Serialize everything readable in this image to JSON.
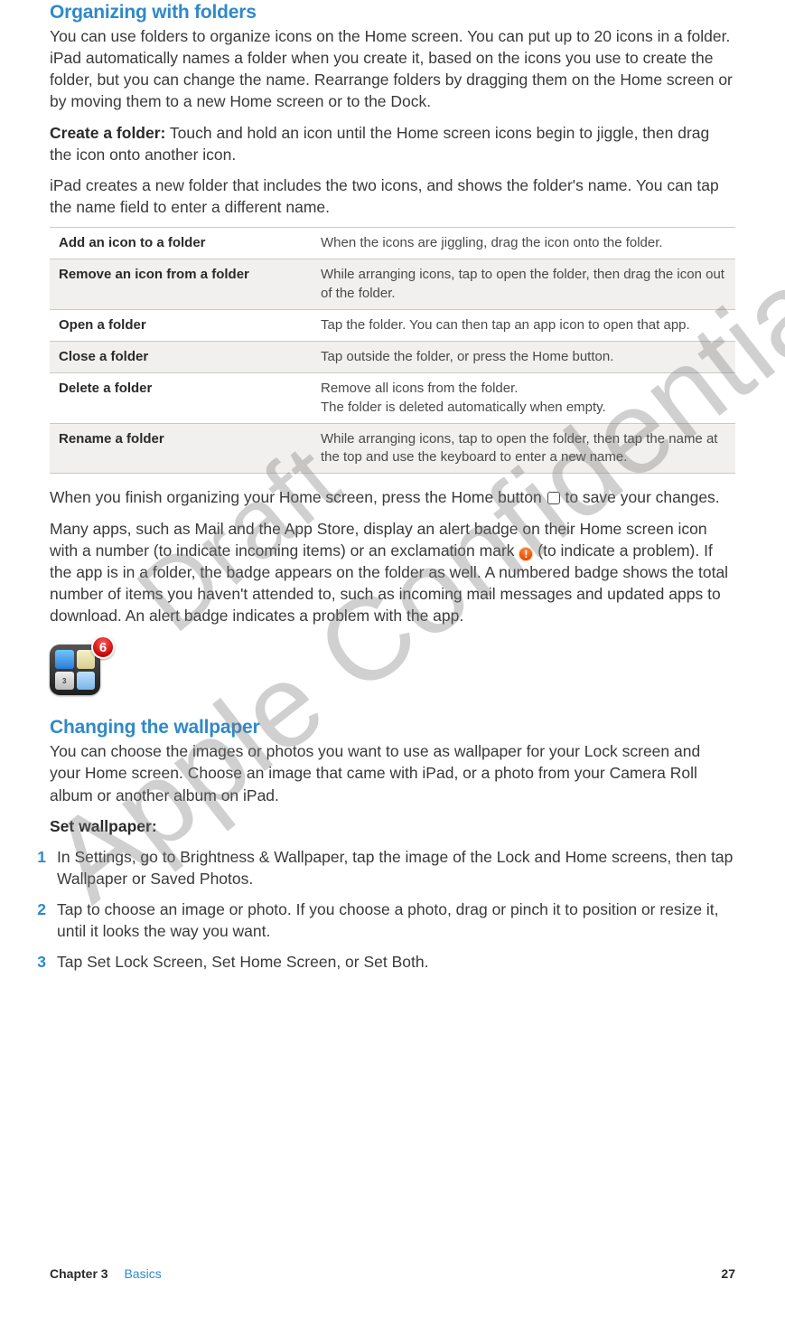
{
  "section1": {
    "heading": "Organizing with folders",
    "para1": "You can use folders to organize icons on the Home screen. You can put up to 20 icons in a folder. iPad automatically names a folder when you create it, based on the icons you use to create the folder, but you can change the name. Rearrange folders by dragging them on the Home screen or by moving them to a new Home screen or to the Dock.",
    "create_lead": "Create a folder:",
    "create_text": "  Touch and hold an icon until the Home screen icons begin to jiggle, then drag the icon onto another icon.",
    "para2": "iPad creates a new folder that includes the two icons, and shows the folder's name. You can tap the name field to enter a different name.",
    "table": [
      {
        "action": "Add an icon to a folder",
        "desc": "When the icons are jiggling, drag the icon onto the folder."
      },
      {
        "action": "Remove an icon from a folder",
        "desc": "While arranging icons, tap to open the folder, then drag the icon out of the folder."
      },
      {
        "action": "Open a folder",
        "desc": "Tap the folder. You can then tap an app icon to open that app."
      },
      {
        "action": "Close a folder",
        "desc": "Tap outside the folder, or press the Home button."
      },
      {
        "action": "Delete a folder",
        "desc": "Remove all icons from the folder.\nThe folder is deleted automatically when empty."
      },
      {
        "action": "Rename a folder",
        "desc": "While arranging icons, tap to open the folder, then tap the name at the top and use the keyboard to enter a new name."
      }
    ],
    "after_table_1a": "When you finish organizing your Home screen, press the Home button ",
    "after_table_1b": " to save your changes.",
    "after_table_2a": "Many apps, such as Mail and the App Store, display an alert badge on their Home screen icon with a number (to indicate incoming items) or an exclamation mark ",
    "after_table_2b": " (to indicate a problem). If the app is in a folder, the badge appears on the folder as well. A numbered badge shows the total number of items you haven't attended to, such as incoming mail messages and updated apps to download. An alert badge indicates a problem with the app.",
    "badge_count": "6"
  },
  "section2": {
    "heading": "Changing the wallpaper",
    "para1": "You can choose the images or photos you want to use as wallpaper for your Lock screen and your Home screen. Choose an image that came with iPad, or a photo from your Camera Roll album or another album on iPad.",
    "set_lead": "Set wallpaper:",
    "steps": [
      {
        "n": "1",
        "t": "In Settings, go to Brightness & Wallpaper, tap the image of the Lock and Home screens, then tap Wallpaper or Saved Photos."
      },
      {
        "n": "2",
        "t": "Tap to choose an image or photo. If you choose a photo, drag or pinch it to position or resize it, until it looks the way you want."
      },
      {
        "n": "3",
        "t": "Tap Set Lock Screen, Set Home Screen, or Set Both."
      }
    ]
  },
  "watermarks": {
    "draft": "Draft",
    "confidential": "Apple Confidential"
  },
  "footer": {
    "chapter_label": "Chapter 3",
    "chapter_name": "Basics",
    "page": "27"
  }
}
